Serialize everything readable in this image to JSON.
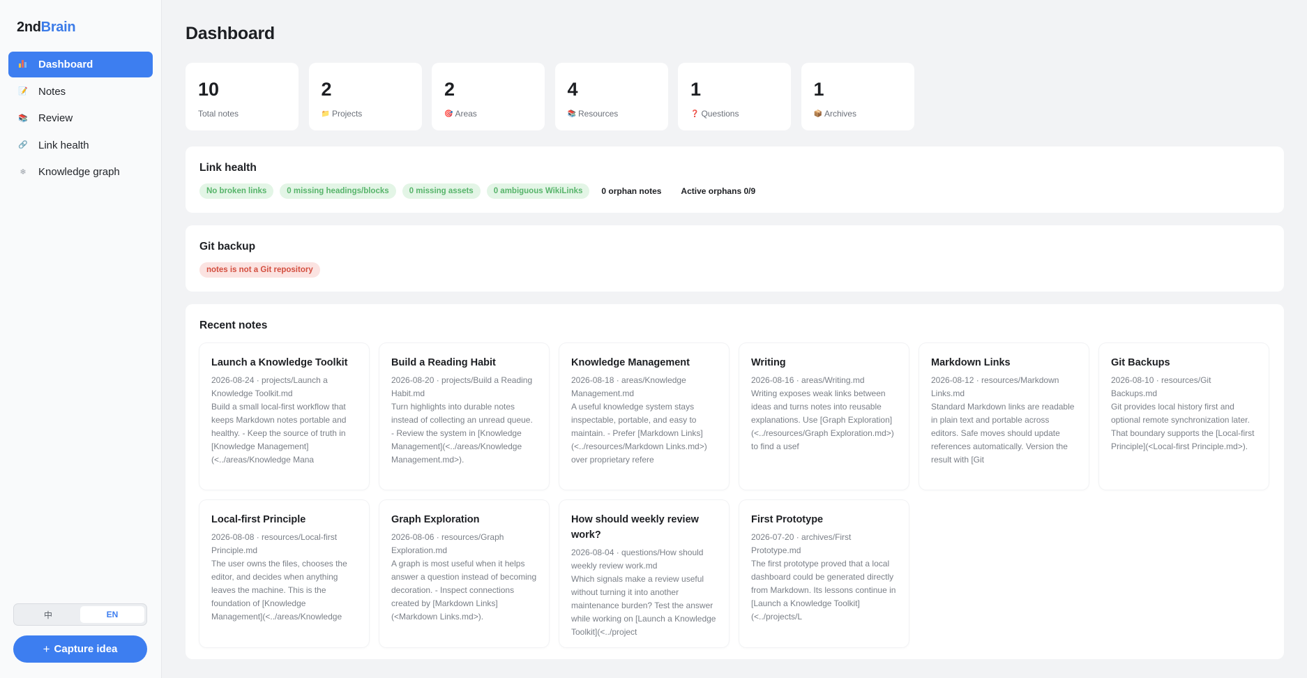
{
  "app": {
    "logo_a": "2nd",
    "logo_b": "Brain"
  },
  "sidebar": {
    "items": [
      {
        "label": "Dashboard",
        "icon": "bar-chart-icon",
        "active": true
      },
      {
        "label": "Notes",
        "icon": "memo-icon",
        "glyph": "📝"
      },
      {
        "label": "Review",
        "icon": "books-icon",
        "glyph": "📚"
      },
      {
        "label": "Link health",
        "icon": "link-icon",
        "glyph": "🔗"
      },
      {
        "label": "Knowledge graph",
        "icon": "snowflake-icon",
        "glyph": "❄"
      }
    ],
    "lang": {
      "zh": "中",
      "en": "EN",
      "selected": "EN"
    },
    "capture_plus": "+",
    "capture_label": "Capture idea"
  },
  "main": {
    "title": "Dashboard",
    "stats": [
      {
        "value": "10",
        "label": "Total notes",
        "glyph": ""
      },
      {
        "value": "2",
        "label": "Projects",
        "glyph": "📁",
        "icon": "folder-icon"
      },
      {
        "value": "2",
        "label": "Areas",
        "glyph": "🎯",
        "icon": "target-icon"
      },
      {
        "value": "4",
        "label": "Resources",
        "glyph": "📚",
        "icon": "books-icon"
      },
      {
        "value": "1",
        "label": "Questions",
        "glyph": "❓",
        "icon": "question-icon"
      },
      {
        "value": "1",
        "label": "Archives",
        "glyph": "📦",
        "icon": "box-icon"
      }
    ],
    "link_health": {
      "title": "Link health",
      "chips": [
        "No broken links",
        "0 missing headings/blocks",
        "0 missing assets",
        "0 ambiguous WikiLinks"
      ],
      "orphans": "0 orphan notes",
      "active_orphans": "Active orphans 0/9"
    },
    "git": {
      "title": "Git backup",
      "status": "notes is not a Git repository"
    },
    "recent": {
      "title": "Recent notes",
      "notes": [
        {
          "title": "Launch a Knowledge Toolkit",
          "meta": "2026-08-24 · projects/Launch a Knowledge Toolkit.md",
          "excerpt": "Build a small local-first workflow that keeps Markdown notes portable and healthy. - Keep the source of truth in [Knowledge Management](<../areas/Knowledge Mana"
        },
        {
          "title": "Build a Reading Habit",
          "meta": "2026-08-20 · projects/Build a Reading Habit.md",
          "excerpt": "Turn highlights into durable notes instead of collecting an unread queue. - Review the system in [Knowledge Management](<../areas/Knowledge Management.md>)."
        },
        {
          "title": "Knowledge Management",
          "meta": "2026-08-18 · areas/Knowledge Management.md",
          "excerpt": "A useful knowledge system stays inspectable, portable, and easy to maintain. - Prefer [Markdown Links](<../resources/Markdown Links.md>) over proprietary refere"
        },
        {
          "title": "Writing",
          "meta": "2026-08-16 · areas/Writing.md",
          "excerpt": "Writing exposes weak links between ideas and turns notes into reusable explanations. Use [Graph Exploration](<../resources/Graph Exploration.md>) to find a usef"
        },
        {
          "title": "Markdown Links",
          "meta": "2026-08-12 · resources/Markdown Links.md",
          "excerpt": "Standard Markdown links are readable in plain text and portable across editors. Safe moves should update references automatically. Version the result with [Git"
        },
        {
          "title": "Git Backups",
          "meta": "2026-08-10 · resources/Git Backups.md",
          "excerpt": "Git provides local history first and optional remote synchronization later. That boundary supports the [Local-first Principle](<Local-first Principle.md>)."
        },
        {
          "title": "Local-first Principle",
          "meta": "2026-08-08 · resources/Local-first Principle.md",
          "excerpt": "The user owns the files, chooses the editor, and decides when anything leaves the machine. This is the foundation of [Knowledge Management](<../areas/Knowledge"
        },
        {
          "title": "Graph Exploration",
          "meta": "2026-08-06 · resources/Graph Exploration.md",
          "excerpt": "A graph is most useful when it helps answer a question instead of becoming decoration. - Inspect connections created by [Markdown Links](<Markdown Links.md>)."
        },
        {
          "title": "How should weekly review work?",
          "meta": "2026-08-04 · questions/How should weekly review work.md",
          "excerpt": "Which signals make a review useful without turning it into another maintenance burden? Test the answer while working on [Launch a Knowledge Toolkit](<../project"
        },
        {
          "title": "First Prototype",
          "meta": "2026-07-20 · archives/First Prototype.md",
          "excerpt": "The first prototype proved that a local dashboard could be generated directly from Markdown. Its lessons continue in [Launch a Knowledge Toolkit](<../projects/L"
        }
      ]
    }
  },
  "colors": {
    "accent": "#3d7ef0",
    "ok_bg": "#e3f5e6",
    "ok_fg": "#57b46a",
    "err_bg": "#fbe3e1",
    "err_fg": "#d34e3f"
  }
}
